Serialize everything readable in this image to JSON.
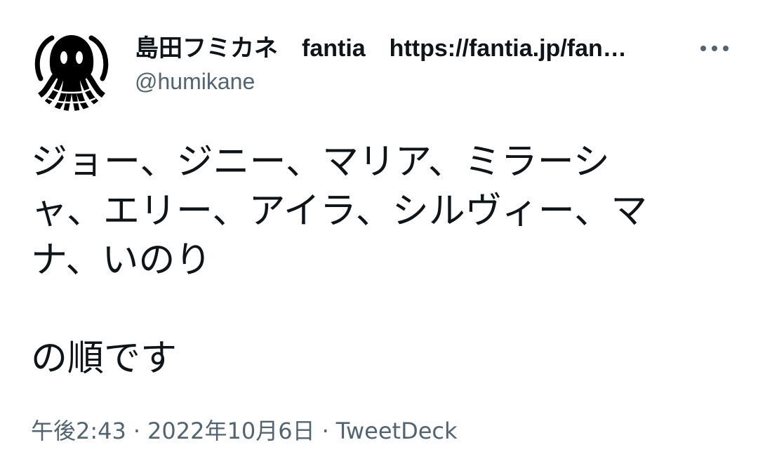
{
  "author": {
    "display_name": "島田フミカネ　fantia　https://fantia.jp/fan…",
    "handle": "@humikane",
    "avatar": "octopus-logo-icon"
  },
  "menu": {
    "icon": "more-dots-icon"
  },
  "tweet": {
    "line1": "ジョー、ジニー、マリア、ミラーシ",
    "line2": "ャ、エリー、アイラ、シルヴィー、マ",
    "line3": "ナ、いのり",
    "line4": "の順です"
  },
  "meta": {
    "time": "午後2:43",
    "separator": "·",
    "date": "2022年10月6日",
    "source": "TweetDeck"
  },
  "colors": {
    "text": "#0f1419",
    "secondary": "#536471",
    "background": "#ffffff"
  }
}
